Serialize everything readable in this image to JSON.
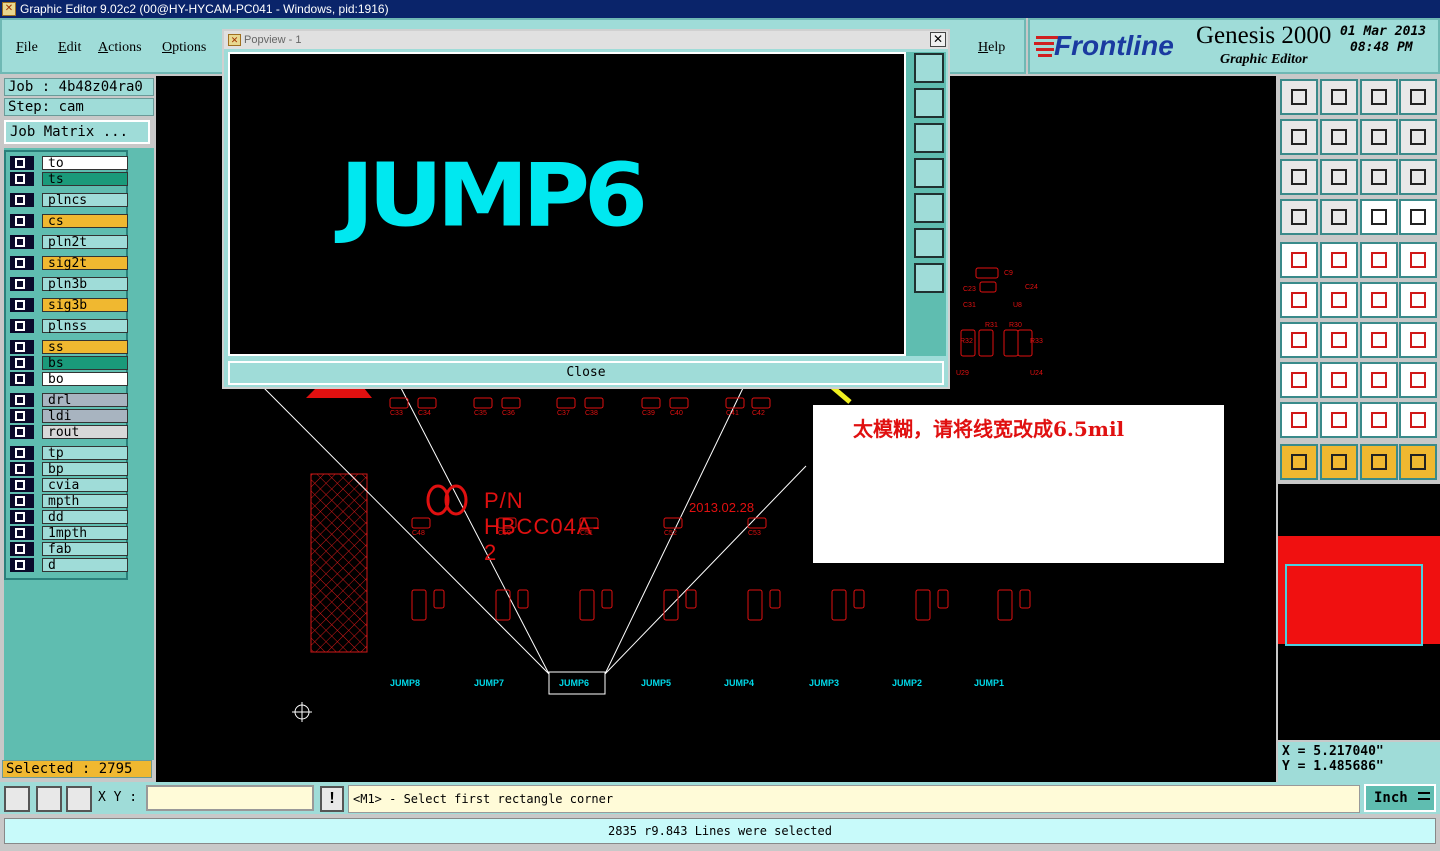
{
  "window": {
    "title": "Graphic Editor 9.02c2 (00@HY-HYCAM-PC041 - Windows, pid:1916)"
  },
  "menu": {
    "file": "File",
    "edit": "Edit",
    "actions": "Actions",
    "options": "Options",
    "help": "Help"
  },
  "brand": {
    "logo": "Frontline",
    "product": "Genesis 2000",
    "subtitle": "Graphic Editor",
    "date": "01 Mar 2013",
    "time": "08:48 PM"
  },
  "job": {
    "job_label": "Job : 4b48z04ra0",
    "step_label": "Step: cam",
    "matrix_button": "Job Matrix ..."
  },
  "layers": [
    {
      "name": "to",
      "color": "#ffffff"
    },
    {
      "name": "ts",
      "color": "#1a9a7a"
    },
    {
      "name": "plncs",
      "color": "#9fdcd8"
    },
    {
      "name": "cs",
      "color": "#f0b830"
    },
    {
      "name": "pln2t",
      "color": "#9fdcd8"
    },
    {
      "name": "sig2t",
      "color": "#f0b830"
    },
    {
      "name": "pln3b",
      "color": "#9fdcd8"
    },
    {
      "name": "sig3b",
      "color": "#f0b830"
    },
    {
      "name": "plnss",
      "color": "#9fdcd8"
    },
    {
      "name": "ss",
      "color": "#f0b830"
    },
    {
      "name": "bs",
      "color": "#1a9a7a"
    },
    {
      "name": "bo",
      "color": "#ffffff"
    },
    {
      "name": "drl",
      "color": "#a8b4c0"
    },
    {
      "name": "ldi",
      "color": "#a8b4c0"
    },
    {
      "name": "rout",
      "color": "#d8d8d8"
    },
    {
      "name": "tp",
      "color": "#9fdcd8"
    },
    {
      "name": "bp",
      "color": "#9fdcd8"
    },
    {
      "name": "cvia",
      "color": "#9fdcd8"
    },
    {
      "name": "mpth",
      "color": "#9fdcd8"
    },
    {
      "name": "dd",
      "color": "#9fdcd8"
    },
    {
      "name": "1mpth",
      "color": "#9fdcd8"
    },
    {
      "name": "fab",
      "color": "#9fdcd8"
    },
    {
      "name": "d",
      "color": "#9fdcd8"
    }
  ],
  "selected": "Selected : 2795",
  "popview": {
    "title": "Popview - 1",
    "zoom_text": "JUMP6",
    "close": "Close"
  },
  "annotation": {
    "text": "太模糊，请将线宽改成6.5mil"
  },
  "board": {
    "pn": "P/N HBCC04A-2",
    "date": "2013.02.28",
    "jumps": [
      "JUMP8",
      "JUMP7",
      "JUMP6",
      "JUMP5",
      "JUMP4",
      "JUMP3",
      "JUMP2",
      "JUMP1"
    ],
    "caps_row1": [
      "C33",
      "C34",
      "C35",
      "C36",
      "C37",
      "C38",
      "C39",
      "C40",
      "C41",
      "C42"
    ],
    "caps_row2": [
      "C48",
      "C50",
      "C51",
      "C52",
      "C53"
    ],
    "upper_parts": [
      "C9",
      "C23",
      "C24",
      "C31",
      "U8",
      "R31",
      "R30",
      "R32",
      "R33",
      "U29",
      "U24"
    ]
  },
  "coords": {
    "x": "X = 5.217040\"",
    "y": "Y = 1.485686\""
  },
  "statusbar": {
    "xy_label": "X Y :",
    "xy_value": "",
    "message": "<M1> - Select first rectangle corner",
    "units": "Inch",
    "bottom": "2835 r9.843 Lines were selected"
  }
}
